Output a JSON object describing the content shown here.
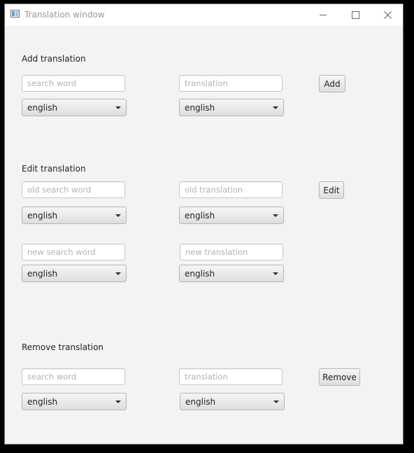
{
  "window": {
    "title": "Translation window"
  },
  "add": {
    "heading": "Add translation",
    "search_placeholder": "search word",
    "translation_placeholder": "translation",
    "button": "Add",
    "lang_from": "english",
    "lang_to": "english"
  },
  "edit": {
    "heading": "Edit translation",
    "old_search_placeholder": "old search word",
    "old_translation_placeholder": "old translation",
    "button": "Edit",
    "old_lang_from": "english",
    "old_lang_to": "english",
    "new_search_placeholder": "new search word",
    "new_translation_placeholder": "new translation",
    "new_lang_from": "english",
    "new_lang_to": "english"
  },
  "remove": {
    "heading": "Remove translation",
    "search_placeholder": "search word",
    "translation_placeholder": "translation",
    "button": "Remove",
    "lang_from": "english",
    "lang_to": "english"
  }
}
